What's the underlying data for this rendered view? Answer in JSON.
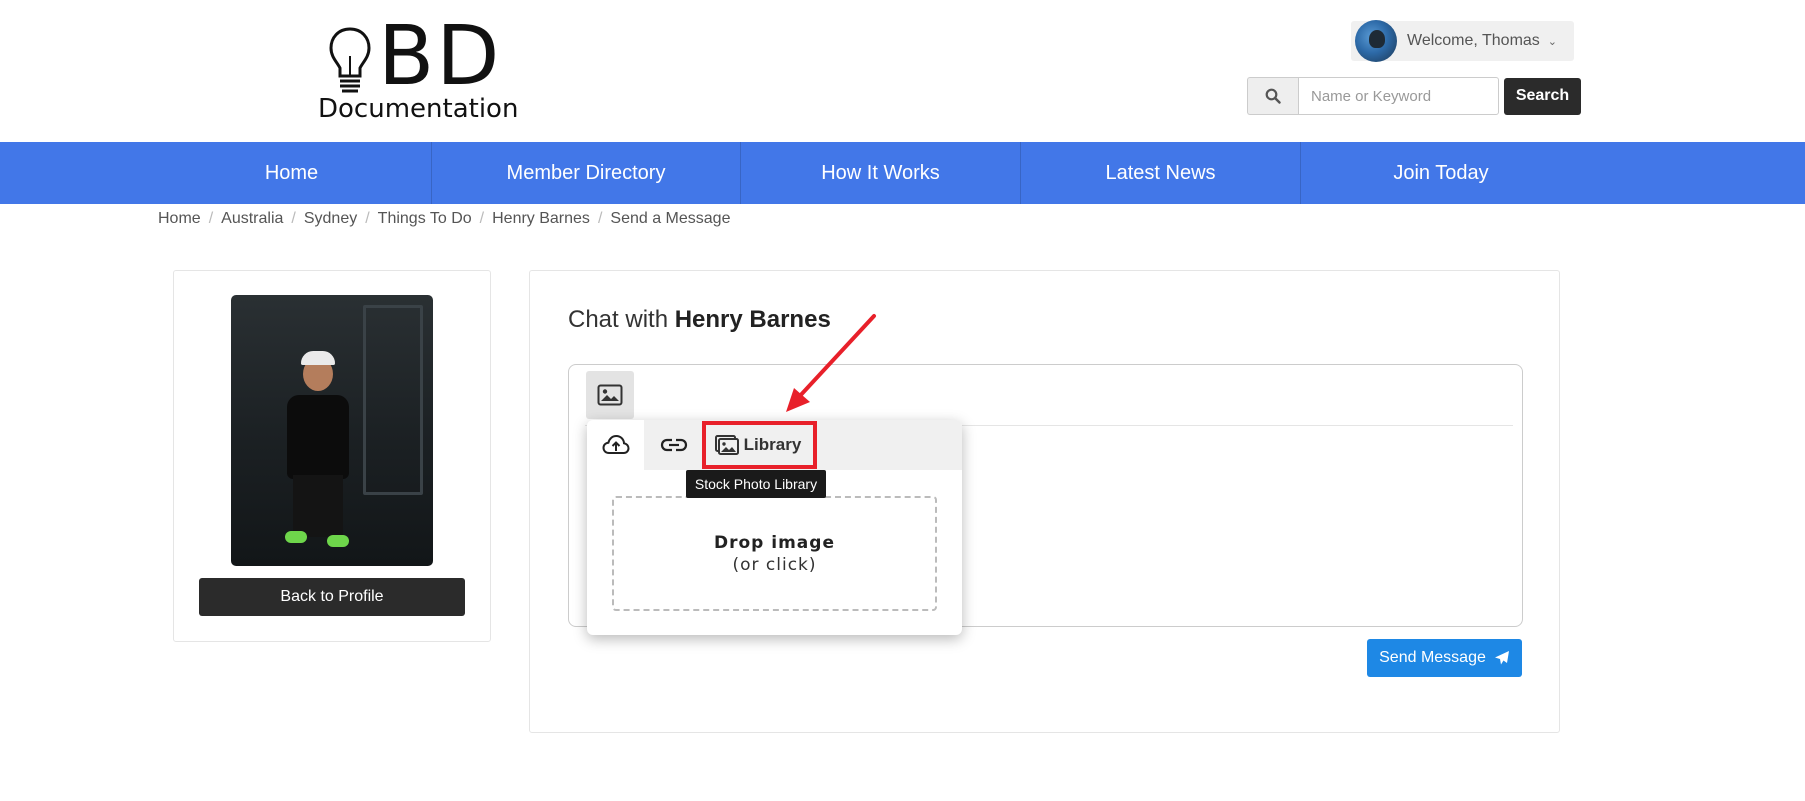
{
  "logo": {
    "big": "BD",
    "small": "Documentation"
  },
  "header": {
    "welcome": "Welcome, Thomas",
    "search_placeholder": "Name or Keyword",
    "search_button": "Search"
  },
  "nav": {
    "items": [
      {
        "label": "Home"
      },
      {
        "label": "Member Directory"
      },
      {
        "label": "How It Works"
      },
      {
        "label": "Latest News"
      },
      {
        "label": "Join Today"
      }
    ]
  },
  "breadcrumb": [
    "Home",
    "Australia",
    "Sydney",
    "Things To Do",
    "Henry Barnes",
    "Send a Message"
  ],
  "profile": {
    "back_button": "Back to Profile"
  },
  "chat": {
    "title_prefix": "Chat with",
    "contact_name": "Henry Barnes",
    "send_button": "Send Message"
  },
  "image_popup": {
    "library_tab": "Library",
    "tooltip": "Stock Photo Library",
    "drop_title": "Drop image",
    "drop_sub": "(or click)"
  },
  "colors": {
    "nav_bg": "#4277e8",
    "send_button": "#1e88e5",
    "annotation": "#e8202a",
    "dark_button": "#2b2b2b"
  },
  "icons": {
    "search": "search-icon",
    "image": "image-icon",
    "upload": "cloud-upload-icon",
    "link": "link-icon",
    "library": "images-icon",
    "send": "paper-plane-icon"
  }
}
